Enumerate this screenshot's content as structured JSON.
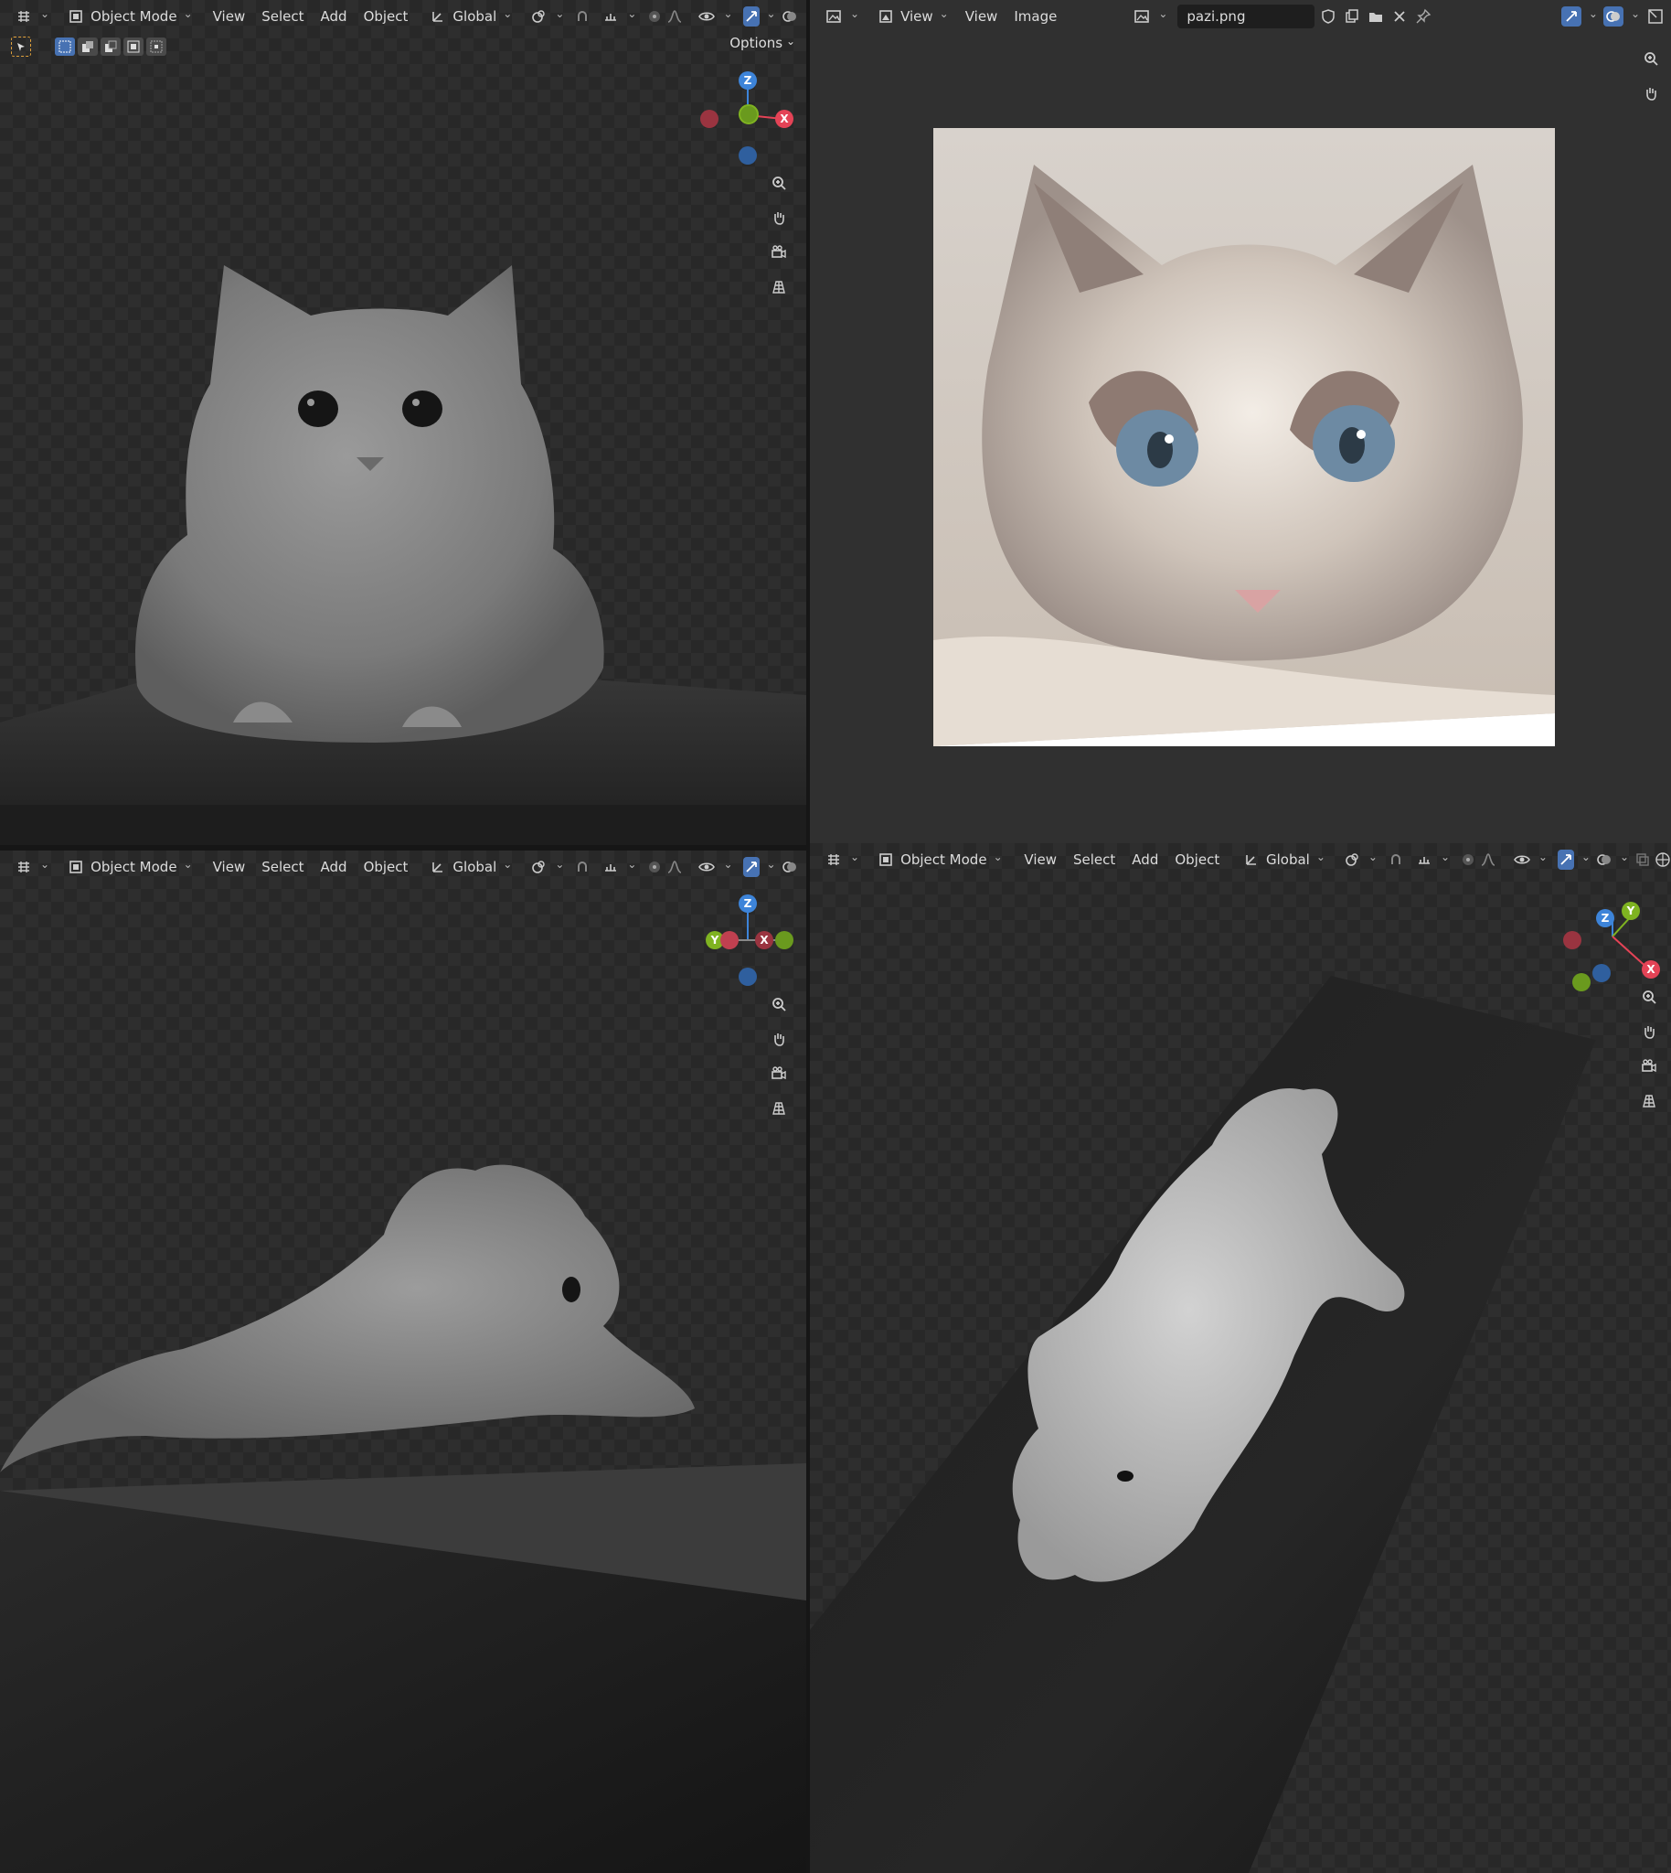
{
  "viewport_header": {
    "mode_label": "Object Mode",
    "view_label": "View",
    "select_label": "Select",
    "add_label": "Add",
    "object_label": "Object",
    "transform_label": "Global"
  },
  "viewport_top_left": {
    "options_label": "Options"
  },
  "image_editor": {
    "view_mode_label": "View",
    "view_menu_label": "View",
    "image_menu_label": "Image",
    "filename": "pazi.png"
  },
  "gizmo_axes": {
    "x": "X",
    "y": "Y",
    "z": "Z"
  },
  "colors": {
    "accent": "#4772b3",
    "axis_x": "#e44356",
    "axis_y": "#7fb321",
    "axis_z": "#3d84d9",
    "selection_outline": "#e0a13c"
  },
  "icons": {
    "editor_type": "view3d-icon",
    "object_mode": "object-mode-icon",
    "transform": "transform-orientation-icon",
    "pivot": "pivot-icon",
    "snap": "snap-icon",
    "proportional": "proportional-edit-icon",
    "visibility": "visibility-icon",
    "gizmo": "gizmo-toggle-icon",
    "overlay": "overlay-icon",
    "zoom": "zoom-icon",
    "pan": "hand-icon",
    "camera": "camera-icon",
    "grid": "ortho-grid-icon"
  }
}
